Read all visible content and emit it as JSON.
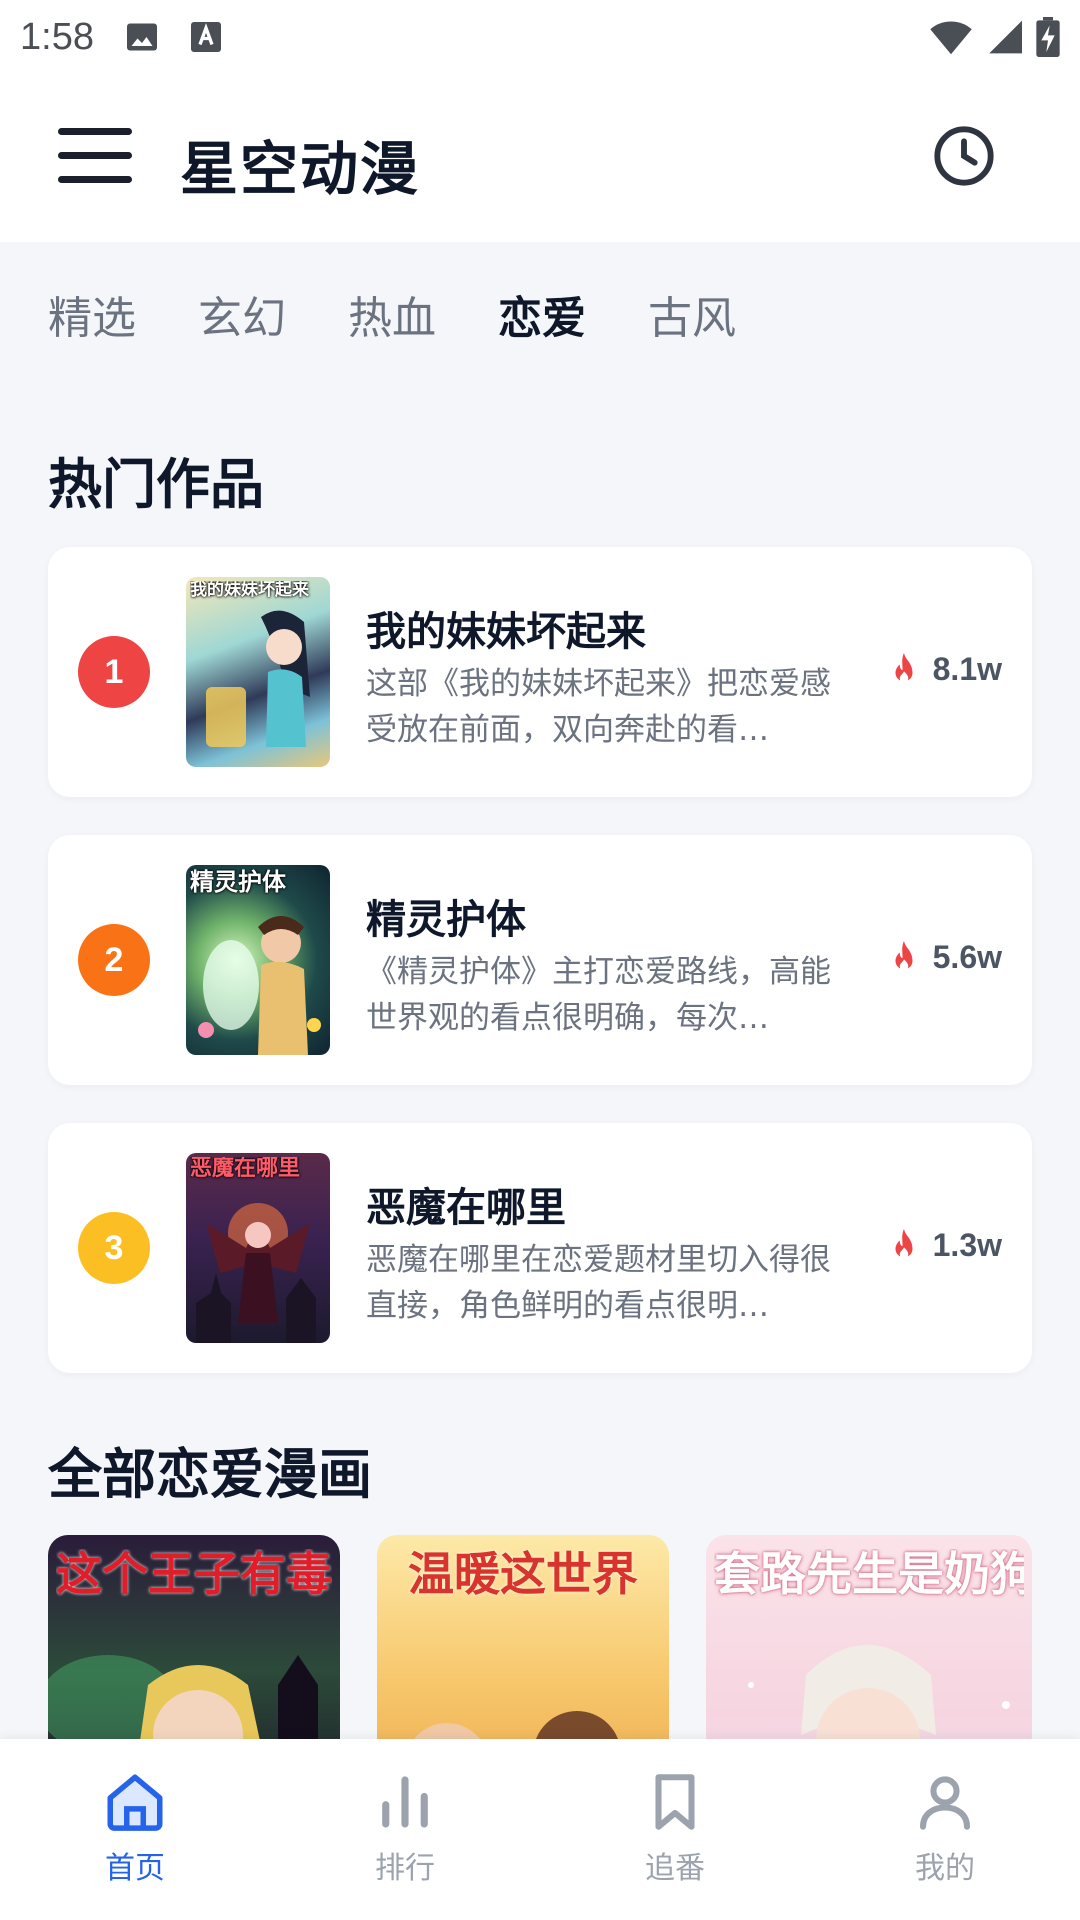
{
  "status_bar": {
    "time": "1:58",
    "icons": [
      "image-icon",
      "a-letter-icon",
      "wifi-icon",
      "signal-icon",
      "battery-charging-icon"
    ]
  },
  "app_bar": {
    "title": "星空动漫",
    "menu_icon": "hamburger-menu-icon",
    "history_icon": "clock-icon"
  },
  "tabs": [
    {
      "label": "精选",
      "active": false
    },
    {
      "label": "玄幻",
      "active": false
    },
    {
      "label": "热血",
      "active": false
    },
    {
      "label": "恋爱",
      "active": true
    },
    {
      "label": "古风",
      "active": false
    }
  ],
  "hot_section": {
    "title": "热门作品",
    "items": [
      {
        "rank": "1",
        "rank_color": "#ef4444",
        "cover_title": "我的妹妹坏起来",
        "name": "我的妹妹坏起来",
        "desc": "这部《我的妹妹坏起来》把恋爱感受放在前面，双向奔赴的看…",
        "heat": "8.1w"
      },
      {
        "rank": "2",
        "rank_color": "#f97316",
        "cover_title": "精灵护体",
        "name": "精灵护体",
        "desc": "《精灵护体》主打恋爱路线，高能世界观的看点很明确，每次…",
        "heat": "5.6w"
      },
      {
        "rank": "3",
        "rank_color": "#fbbf24",
        "cover_title": "恶魔在哪里",
        "name": "恶魔在哪里",
        "desc": "恶魔在哪里在恋爱题材里切入得很直接，角色鲜明的看点很明…",
        "heat": "1.3w"
      }
    ]
  },
  "all_section": {
    "title": "全部恋爱漫画",
    "items": [
      {
        "cover_title": "这个王子有毒",
        "title_color": "#e11d2a"
      },
      {
        "cover_title": "温暖这世界",
        "title_color": "#d9342b"
      },
      {
        "cover_title": "套路先生是奶狗",
        "title_color": "#e88aa3"
      }
    ]
  },
  "bottom_nav": {
    "items": [
      {
        "label": "首页",
        "icon": "home-icon",
        "active": true
      },
      {
        "label": "排行",
        "icon": "bar-chart-icon",
        "active": false
      },
      {
        "label": "追番",
        "icon": "bookmark-icon",
        "active": false
      },
      {
        "label": "我的",
        "icon": "user-icon",
        "active": false
      }
    ]
  },
  "colors": {
    "accent": "#2563eb",
    "heat_icon": "#ef4444",
    "page_bg": "#f4f6fa"
  }
}
